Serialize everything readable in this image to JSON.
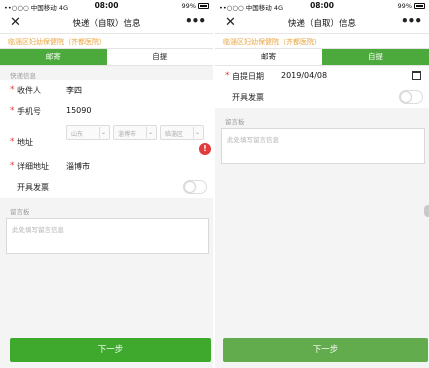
{
  "left": {
    "status": {
      "carrier": "••○○○ 中国移动 4G",
      "time": "08:00",
      "battery": "99%"
    },
    "nav": {
      "title": "快递（自取）信息"
    },
    "hospital": "临淄区妇幼保健院（齐都医院）",
    "tabs": [
      {
        "label": "邮寄"
      },
      {
        "label": "自提"
      }
    ],
    "section": "快递信息",
    "fields": {
      "receiver": {
        "label": "收件人",
        "value": "李四"
      },
      "phone": {
        "label": "手机号",
        "value": "15090"
      },
      "address": {
        "label": "地址",
        "province": "山东",
        "city": "淄博市",
        "district": "临淄区"
      },
      "detail": {
        "label": "详细地址",
        "value": "淄博市"
      },
      "invoice": {
        "label": "开具发票"
      }
    },
    "warning": "!",
    "message": {
      "label": "留言板",
      "placeholder": "此处填写留言信息"
    },
    "next_button": "下一步"
  },
  "right": {
    "status": {
      "carrier": "••○○○ 中国移动 4G",
      "time": "08:00",
      "battery": "99%"
    },
    "nav": {
      "title": "快递（自取）信息"
    },
    "hospital": "临淄区妇幼保健院（齐都医院）",
    "tabs": [
      {
        "label": "邮寄"
      },
      {
        "label": "自提"
      }
    ],
    "fields": {
      "pickup_date": {
        "label": "自提日期",
        "value": "2019/04/08"
      },
      "invoice": {
        "label": "开具发票"
      }
    },
    "message": {
      "label": "留言板",
      "placeholder": "此处填写留言信息"
    },
    "next_button": "下一步"
  },
  "colors": {
    "accent_green": "#4caa3c",
    "hospital_orange": "#e8a33d",
    "required_red": "#e23b3b"
  },
  "icons": {
    "close": "close-icon",
    "more": "more-icon",
    "calendar": "calendar-icon",
    "chevron": "chevron-down-icon"
  }
}
